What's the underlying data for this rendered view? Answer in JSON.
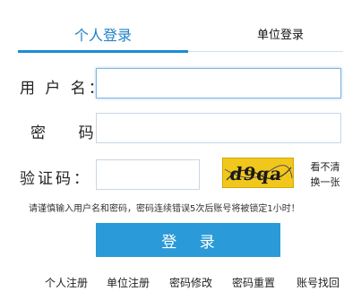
{
  "tabs": {
    "personal": "个人登录",
    "unit": "单位登录"
  },
  "form": {
    "username_label": "用 户 名：",
    "username_value": "",
    "password_label": "密    码：",
    "password_value": "",
    "captcha_label": "验证码：",
    "captcha_value": "",
    "captcha_image_text": "d9qa",
    "refresh_line1": "看不清",
    "refresh_line2": "换一张"
  },
  "hint": "请谨慎输入用户名和密码，密码连续错误5次后账号将被锁定1小时！",
  "login_button": "登 录",
  "footer": {
    "links": [
      "个人注册",
      "单位注册",
      "密码修改",
      "密码重置",
      "账号找回"
    ]
  },
  "colors": {
    "accent": "#2b9ad8",
    "tab_active": "#1e7fc8",
    "captcha_bg": "#f2c71d"
  }
}
